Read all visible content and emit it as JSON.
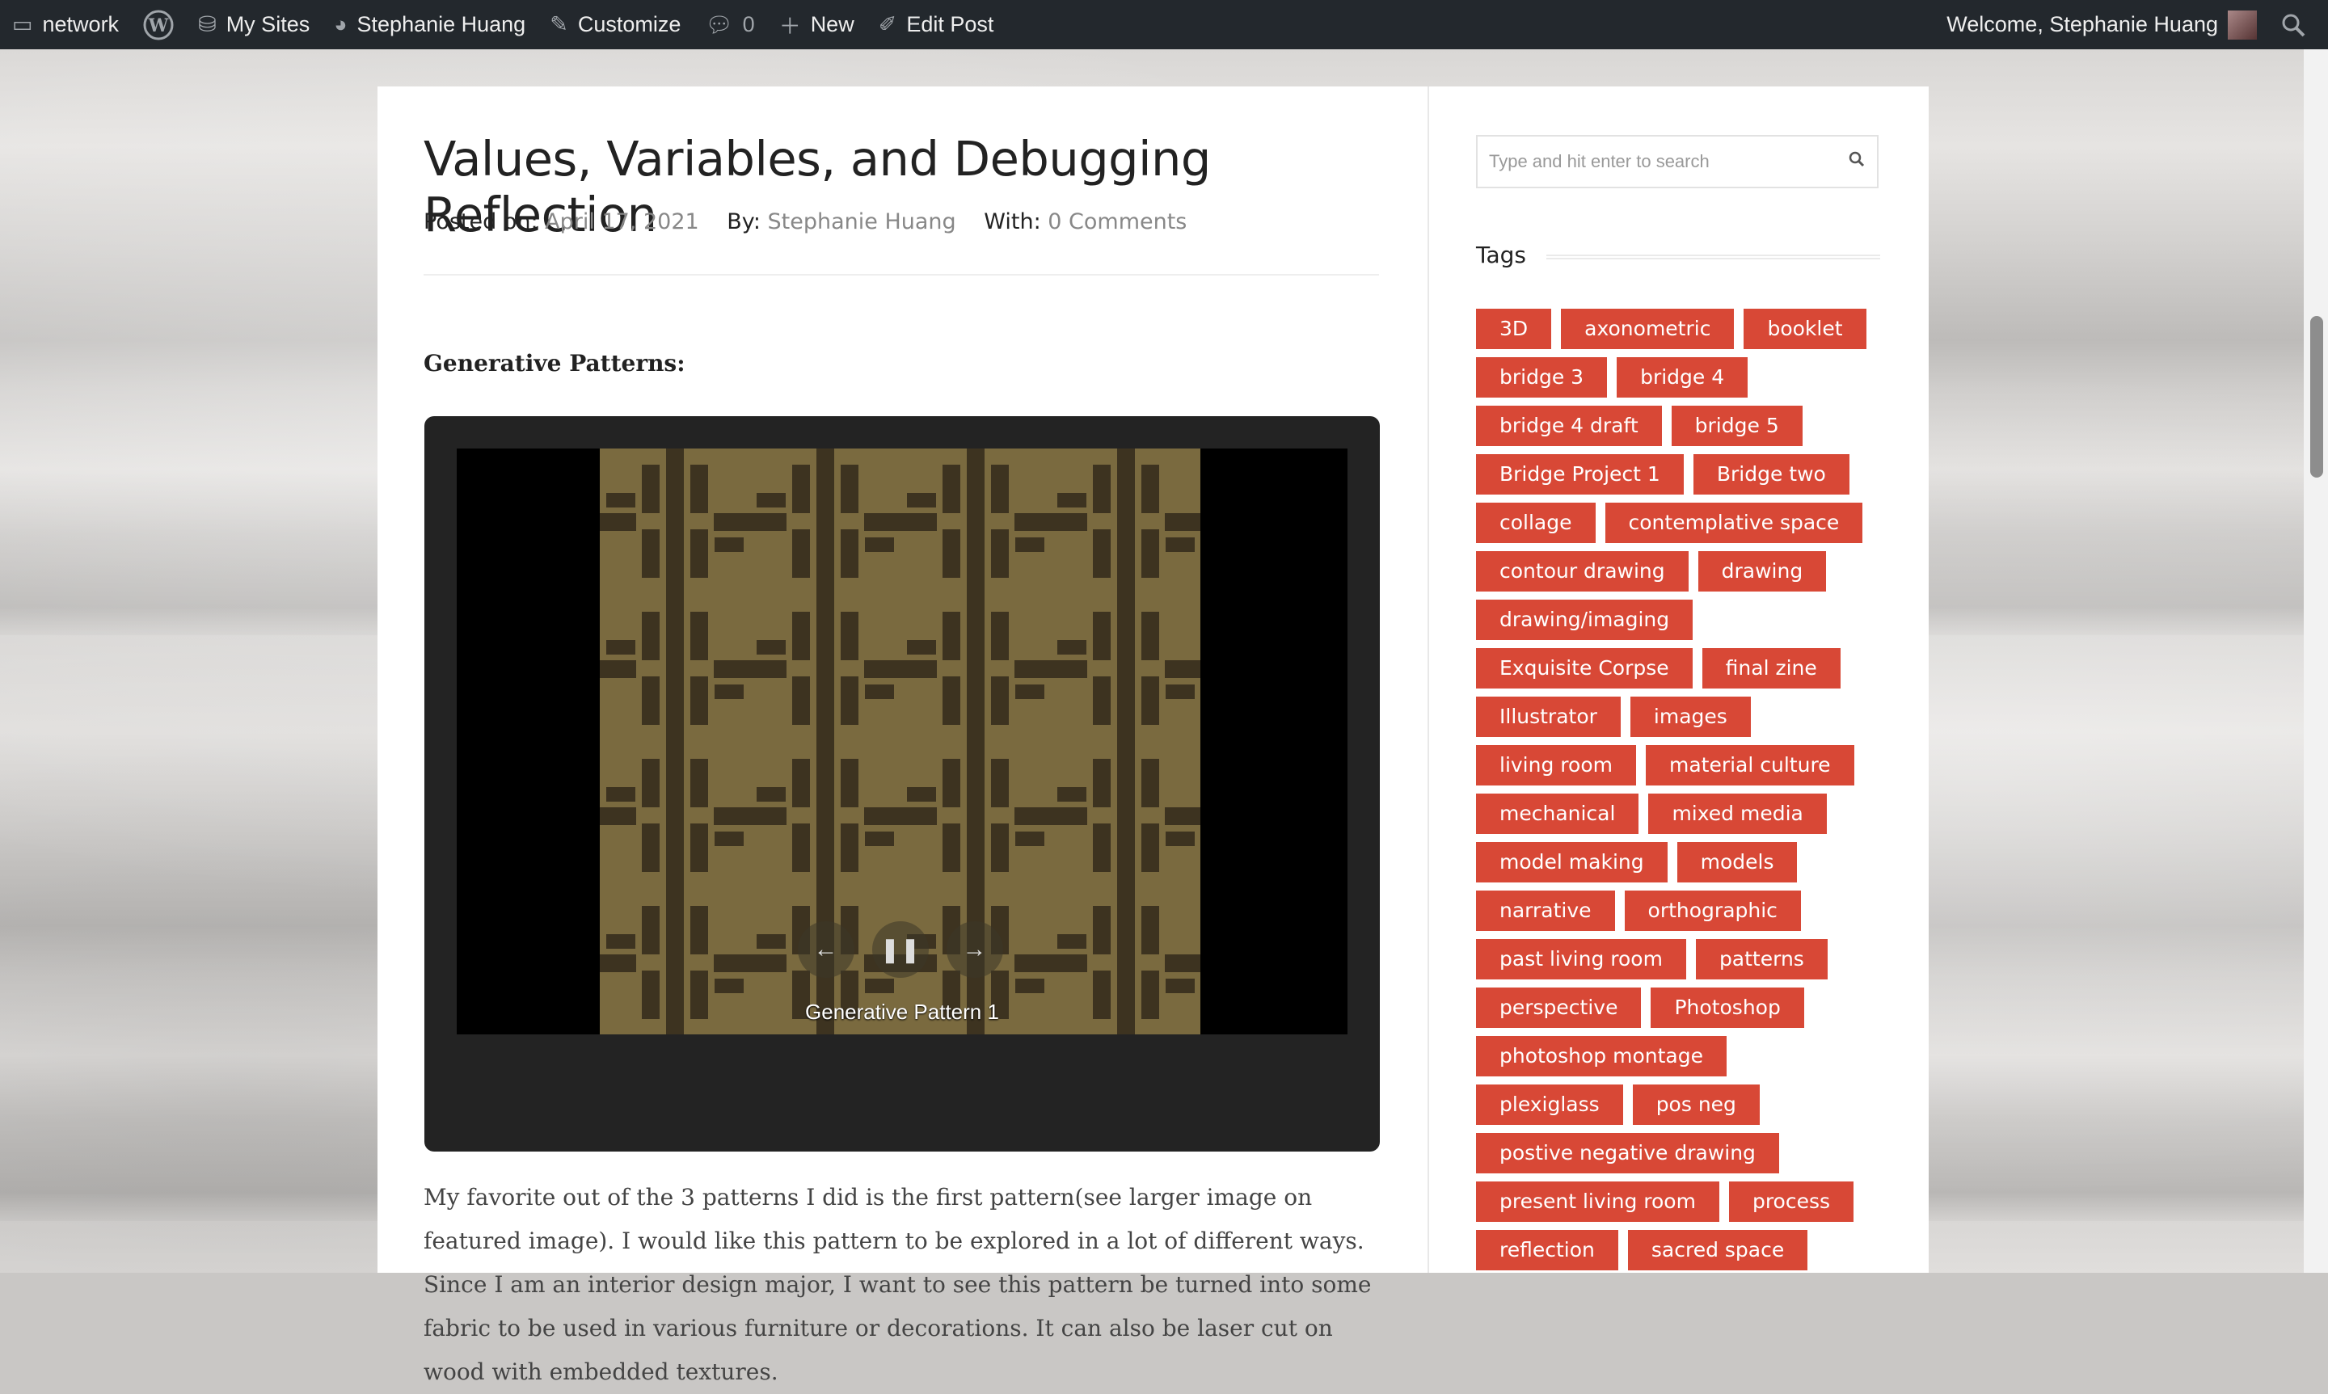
{
  "admin_bar": {
    "network": "network",
    "my_sites": "My Sites",
    "site_name": "Stephanie Huang",
    "customize": "Customize",
    "comments_count": "0",
    "new": "New",
    "edit_post": "Edit Post",
    "welcome": "Welcome, Stephanie Huang"
  },
  "post": {
    "title": "Values, Variables, and Debugging Reflection",
    "posted_on_label": "Posted on:",
    "posted_on": "April 17, 2021",
    "by_label": "By:",
    "author": "Stephanie Huang",
    "with_label": "With:",
    "comments": "0 Comments",
    "subheading": "Generative Patterns:",
    "slide_caption": "Generative Pattern 1",
    "body": "My favorite out of the 3 patterns I did is the first pattern(see larger image on featured image). I would like this pattern to be explored in a lot of different ways. Since I am an interior design major, I want to see this pattern be turned into some fabric to be used in various furniture or decorations. It can also be laser cut on wood with embedded textures."
  },
  "sidebar": {
    "search_placeholder": "Type and hit enter to search",
    "tags_heading": "Tags",
    "tags": [
      "3D",
      "axonometric",
      "booklet",
      "bridge 3",
      "bridge 4",
      "bridge 4 draft",
      "bridge 5",
      "Bridge Project 1",
      "Bridge two",
      "collage",
      "contemplative space",
      "contour drawing",
      "drawing",
      "drawing/imaging",
      "Exquisite Corpse",
      "final zine",
      "Illustrator",
      "images",
      "living room",
      "material culture",
      "mechanical",
      "mixed media",
      "model making",
      "models",
      "narrative",
      "orthographic",
      "past living room",
      "patterns",
      "perspective",
      "Photoshop",
      "photoshop montage",
      "plexiglass",
      "pos neg",
      "postive negative drawing",
      "present living room",
      "process",
      "reflection",
      "sacred space"
    ]
  },
  "colors": {
    "tag_bg": "#d84836",
    "pattern_light": "#7a6a3f",
    "pattern_dark": "#3d3320"
  }
}
